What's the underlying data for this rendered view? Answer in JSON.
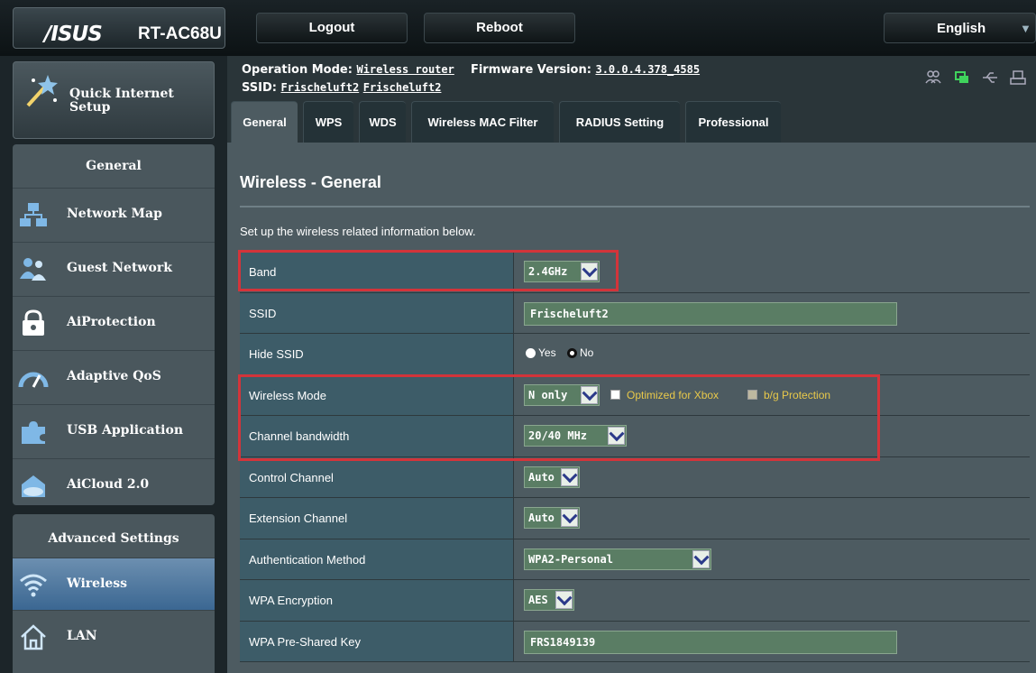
{
  "header": {
    "brand": "/ISUS",
    "model": "RT-AC68U",
    "logout_label": "Logout",
    "reboot_label": "Reboot",
    "language": "English"
  },
  "sidebar": {
    "quick_setup": "Quick Internet Setup",
    "general_title": "General",
    "general_items": [
      {
        "label": "Network Map",
        "icon": "network-map-icon"
      },
      {
        "label": "Guest Network",
        "icon": "guest-network-icon"
      },
      {
        "label": "AiProtection",
        "icon": "lock-icon"
      },
      {
        "label": "Adaptive QoS",
        "icon": "gauge-icon"
      },
      {
        "label": "USB Application",
        "icon": "puzzle-icon"
      },
      {
        "label": "AiCloud 2.0",
        "icon": "cloud-house-icon"
      }
    ],
    "advanced_title": "Advanced Settings",
    "advanced_items": [
      {
        "label": "Wireless",
        "icon": "wifi-icon",
        "active": true
      },
      {
        "label": "LAN",
        "icon": "home-icon",
        "active": false
      }
    ]
  },
  "status": {
    "operation_mode_label": "Operation Mode:",
    "operation_mode": "Wireless router",
    "firmware_label": "Firmware Version:",
    "firmware": "3.0.0.4.378_4585",
    "ssid_label": "SSID:",
    "ssid_1": "Frischeluft2",
    "ssid_2": "Frischeluft2"
  },
  "tabs": [
    "General",
    "WPS",
    "WDS",
    "Wireless MAC Filter",
    "RADIUS Setting",
    "Professional"
  ],
  "page": {
    "title": "Wireless - General",
    "description": "Set up the wireless related information below."
  },
  "settings": {
    "band": {
      "label": "Band",
      "value": "2.4GHz"
    },
    "ssid": {
      "label": "SSID",
      "value": "Frischeluft2"
    },
    "hide_ssid": {
      "label": "Hide SSID",
      "yes": "Yes",
      "no": "No",
      "selected": "No"
    },
    "wireless_mode": {
      "label": "Wireless Mode",
      "value": "N only",
      "xbox": "Optimized for Xbox",
      "bg": "b/g Protection"
    },
    "channel_bandwidth": {
      "label": "Channel bandwidth",
      "value": "20/40 MHz"
    },
    "control_channel": {
      "label": "Control Channel",
      "value": "Auto"
    },
    "extension_channel": {
      "label": "Extension Channel",
      "value": "Auto"
    },
    "auth_method": {
      "label": "Authentication Method",
      "value": "WPA2-Personal"
    },
    "wpa_encryption": {
      "label": "WPA Encryption",
      "value": "AES"
    },
    "wpa_key": {
      "label": "WPA Pre-Shared Key",
      "value": "FRS1849139"
    }
  },
  "colors": {
    "highlight": "#d3343a",
    "active_nav": "#3b6792",
    "option_text": "#e9c94a"
  }
}
